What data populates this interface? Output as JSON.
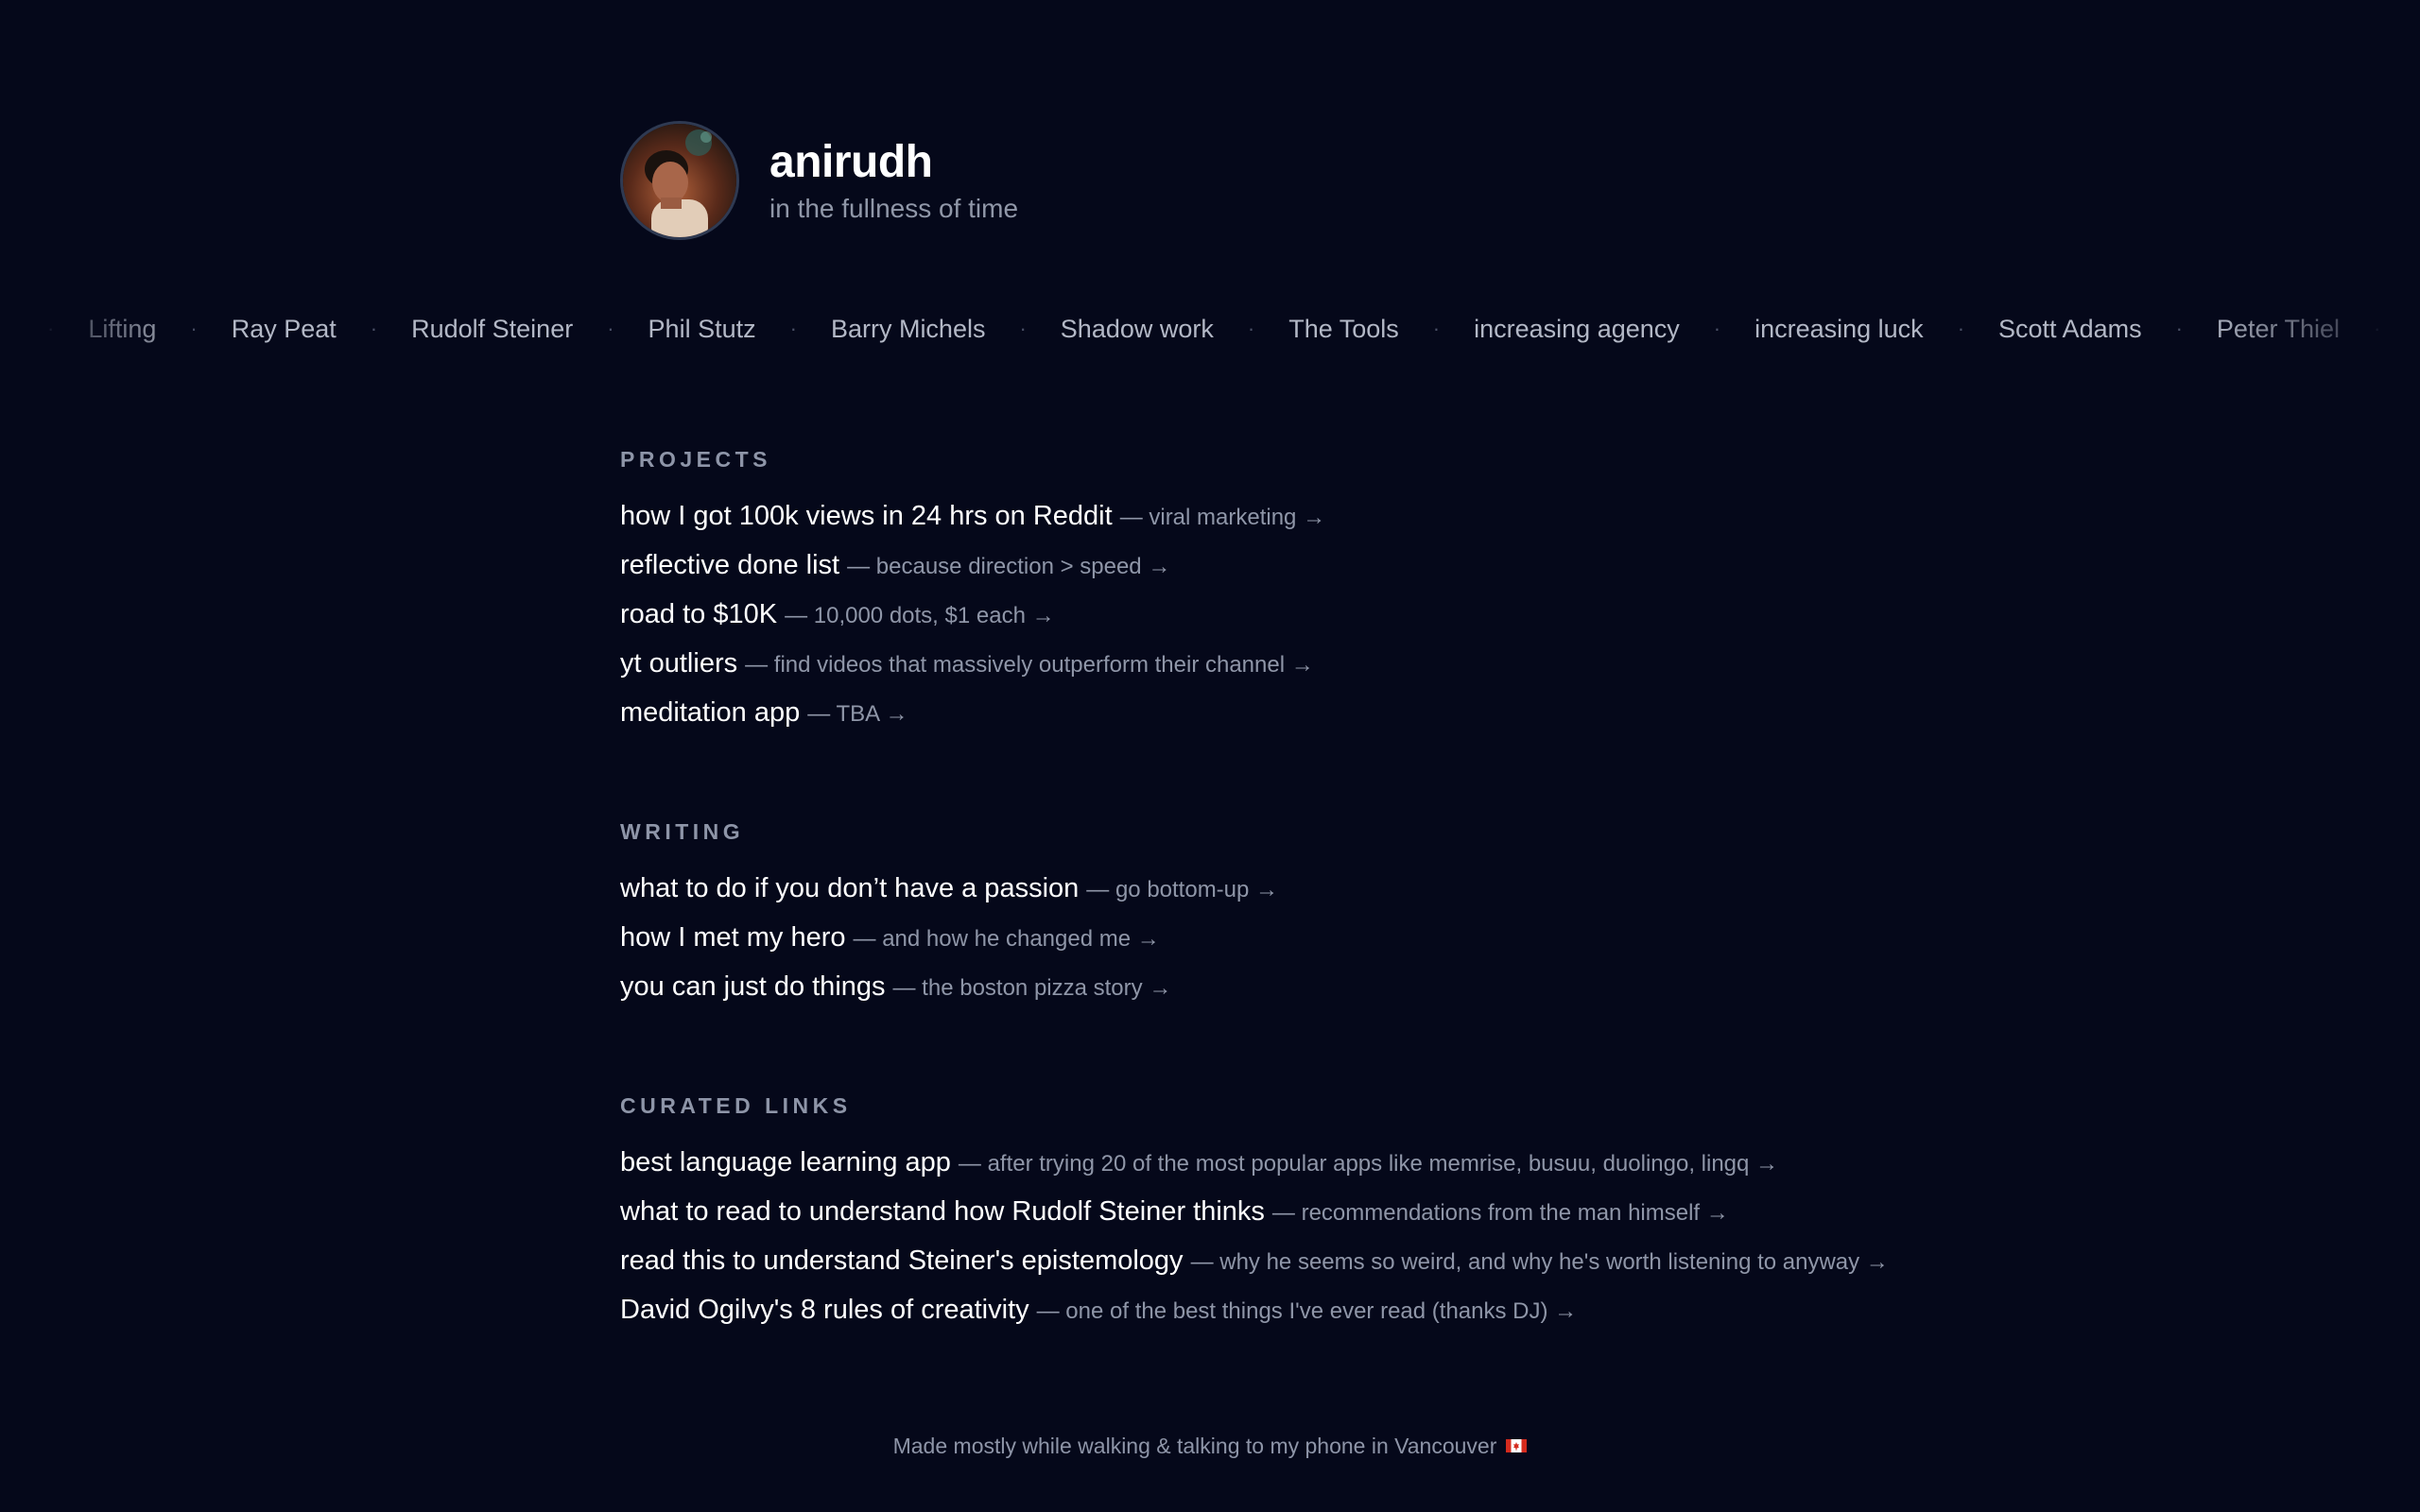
{
  "profile": {
    "name": "anirudh",
    "tagline": "in the fullness of time",
    "avatar_icon": "portrait-photo"
  },
  "ticker": {
    "separator": "·",
    "topics": [
      "Lifting",
      "Ray Peat",
      "Rudolf Steiner",
      "Phil Stutz",
      "Barry Michels",
      "Shadow work",
      "The Tools",
      "increasing agency",
      "increasing luck",
      "Scott Adams",
      "Peter Thiel"
    ]
  },
  "sections": {
    "projects": {
      "heading": "PROJECTS",
      "items": [
        {
          "title": "how I got 100k views in 24 hrs on Reddit",
          "desc": "— viral marketing →"
        },
        {
          "title": "reflective done list",
          "desc": "— because direction > speed →"
        },
        {
          "title": "road to $10K",
          "desc": "— 10,000 dots, $1 each →"
        },
        {
          "title": "yt outliers",
          "desc": "— find videos that massively outperform their channel →"
        },
        {
          "title": "meditation app",
          "desc": "— TBA →"
        }
      ]
    },
    "writing": {
      "heading": "WRITING",
      "items": [
        {
          "title": "what to do if you don’t have a passion",
          "desc": "— go bottom-up →"
        },
        {
          "title": "how I met my hero",
          "desc": "— and how he changed me →"
        },
        {
          "title": "you can just do things",
          "desc": "— the boston pizza story →"
        }
      ]
    },
    "curated": {
      "heading": "CURATED LINKS",
      "items": [
        {
          "title": "best language learning app",
          "desc": "— after trying 20 of the most popular apps like memrise, busuu, duolingo, lingq →"
        },
        {
          "title": "what to read to understand how Rudolf Steiner thinks",
          "desc": "— recommendations from the man himself →"
        },
        {
          "title": "read this to understand Steiner's epistemology",
          "desc": "— why he seems so weird, and why he's worth listening to anyway →"
        },
        {
          "title": "David Ogilvy's 8 rules of creativity",
          "desc": "— one of the best things I've ever read (thanks DJ) →"
        }
      ]
    }
  },
  "footer": {
    "text": "Made mostly while walking & talking to my phone in Vancouver",
    "flag_icon": "canada-flag-icon"
  },
  "colors": {
    "background": "#05081a",
    "primary_text": "#ffffff",
    "muted_text": "#8f96a8"
  }
}
